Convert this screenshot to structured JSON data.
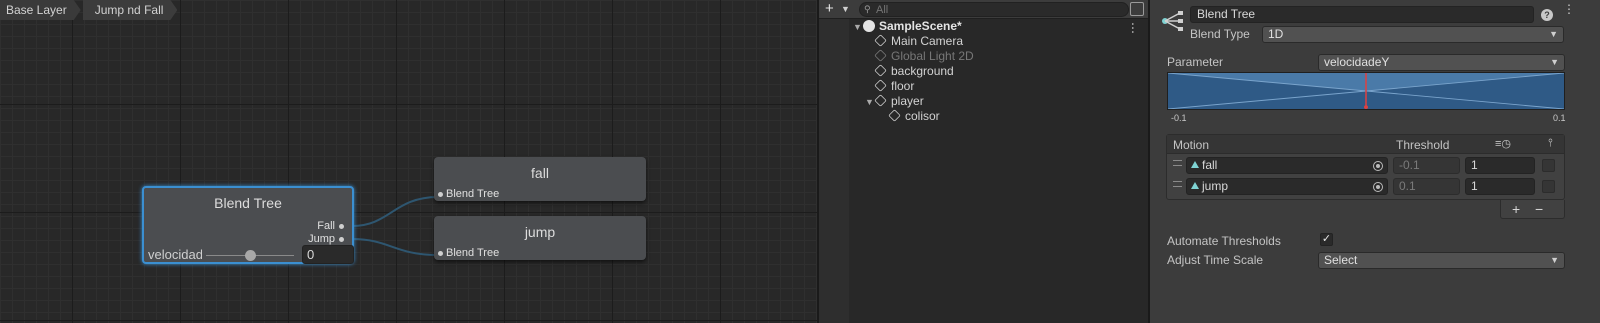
{
  "animator": {
    "breadcrumb": [
      "Base Layer",
      "Jump nd Fall"
    ],
    "blend_tree_node": {
      "title": "Blend Tree",
      "outputs": [
        "Fall",
        "Jump"
      ],
      "parameter_name": "velocidadeY",
      "parameter_value": "0",
      "slider_position": 0.5
    },
    "clip_nodes": [
      {
        "title": "fall",
        "input_label": "Blend Tree"
      },
      {
        "title": "jump",
        "input_label": "Blend Tree"
      }
    ],
    "colors": {
      "selection": "#3b8fd1",
      "grid_major": "#1c1c1c",
      "grid_minor": "#2f2f2f"
    }
  },
  "hierarchy": {
    "search_placeholder": "All",
    "items": [
      {
        "name": "SampleScene*",
        "depth": 0,
        "type": "scene",
        "expanded": true,
        "enabled": true
      },
      {
        "name": "Main Camera",
        "depth": 1,
        "type": "gameobject",
        "enabled": true
      },
      {
        "name": "Global Light 2D",
        "depth": 1,
        "type": "gameobject",
        "enabled": false
      },
      {
        "name": "background",
        "depth": 1,
        "type": "gameobject",
        "enabled": true
      },
      {
        "name": "floor",
        "depth": 1,
        "type": "gameobject",
        "enabled": true
      },
      {
        "name": "player",
        "depth": 1,
        "type": "gameobject",
        "expanded": true,
        "enabled": true
      },
      {
        "name": "colisor",
        "depth": 2,
        "type": "gameobject",
        "enabled": true
      }
    ]
  },
  "inspector": {
    "name": "Blend Tree",
    "blend_type_label": "Blend Type",
    "blend_type_value": "1D",
    "parameter_label": "Parameter",
    "parameter_value": "velocidadeY",
    "graph_min": "-0.1",
    "graph_max": "0.1",
    "graph_marker_position": 0.5,
    "motion_table": {
      "headers": {
        "motion": "Motion",
        "threshold": "Threshold"
      },
      "rows": [
        {
          "motion": "fall",
          "threshold": "-0.1",
          "speed": "1",
          "mirror": false
        },
        {
          "motion": "jump",
          "threshold": "0.1",
          "speed": "1",
          "mirror": false
        }
      ],
      "add_label": "+",
      "remove_label": "−"
    },
    "automate_thresholds_label": "Automate Thresholds",
    "automate_thresholds_checked": true,
    "adjust_time_scale_label": "Adjust Time Scale",
    "adjust_time_scale_value": "Select",
    "colors": {
      "graph_fill": "#3e6a96",
      "graph_marker": "#e04040",
      "clip_icon": "#7fd3d3"
    }
  }
}
